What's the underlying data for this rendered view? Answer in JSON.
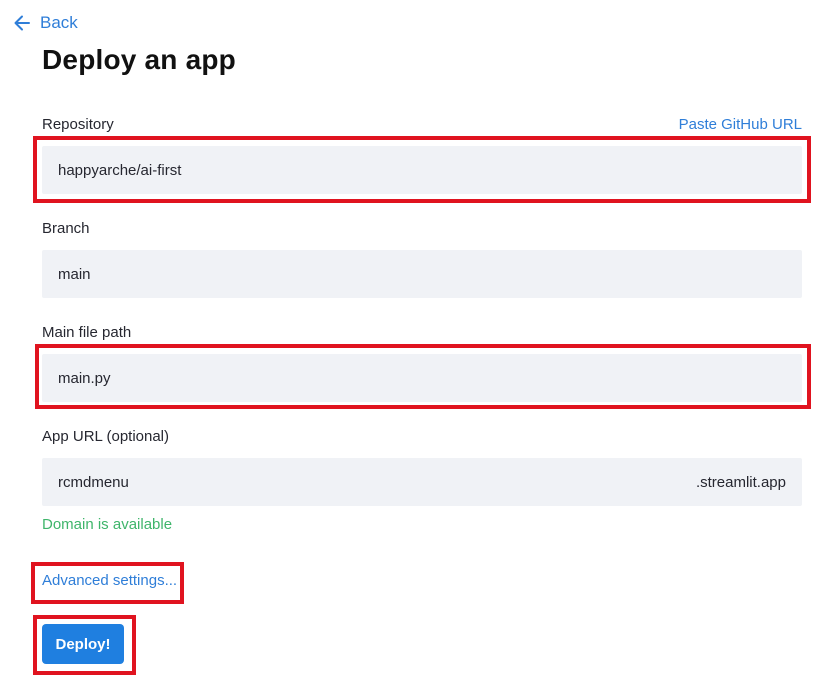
{
  "nav": {
    "back_label": "Back",
    "back_icon": "arrow-left-icon"
  },
  "page": {
    "title": "Deploy an app"
  },
  "repository": {
    "label": "Repository",
    "paste_link": "Paste GitHub URL",
    "value": "happyarche/ai-first"
  },
  "branch": {
    "label": "Branch",
    "value": "main"
  },
  "main_file": {
    "label": "Main file path",
    "value": "main.py"
  },
  "app_url": {
    "label": "App URL (optional)",
    "value": "rcmdmenu",
    "suffix": ".streamlit.app",
    "status": "Domain is available"
  },
  "actions": {
    "advanced_label": "Advanced settings...",
    "deploy_label": "Deploy!"
  },
  "colors": {
    "accent": "#1f7fe0",
    "link": "#2f7ed8",
    "success": "#3fb56b",
    "field_bg": "#f0f2f6",
    "highlight": "#e0131f"
  }
}
